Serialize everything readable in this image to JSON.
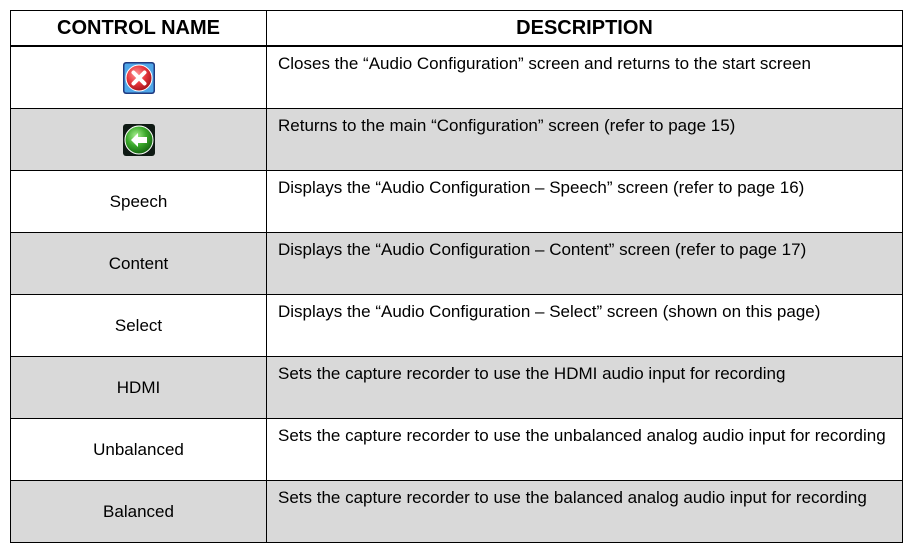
{
  "table": {
    "headers": [
      "CONTROL NAME",
      "DESCRIPTION"
    ],
    "rows": [
      {
        "name": "",
        "icon": "close-icon",
        "description": "Closes the “Audio Configuration” screen and returns to the start screen"
      },
      {
        "name": "",
        "icon": "back-arrow-icon",
        "description": "Returns to the main “Configuration” screen (refer to page 15)"
      },
      {
        "name": "Speech",
        "description": "Displays the “Audio Configuration – Speech” screen (refer to page 16)"
      },
      {
        "name": "Content",
        "description": "Displays the “Audio Configuration – Content” screen (refer to page 17)"
      },
      {
        "name": "Select",
        "description": "Displays the “Audio Configuration – Select” screen (shown on this page)"
      },
      {
        "name": "HDMI",
        "description": "Sets the capture recorder to use the HDMI audio input for recording"
      },
      {
        "name": "Unbalanced",
        "description": "Sets the capture recorder to use the unbalanced analog audio input for recording"
      },
      {
        "name": "Balanced",
        "description": "Sets the capture recorder to use the balanced analog audio input for recording"
      }
    ]
  },
  "colors": {
    "shaded_row": "#d9d9d9",
    "close_icon_red": "#e8383f",
    "back_icon_green": "#3aa82a",
    "icon_frame": "#1f3a80"
  }
}
